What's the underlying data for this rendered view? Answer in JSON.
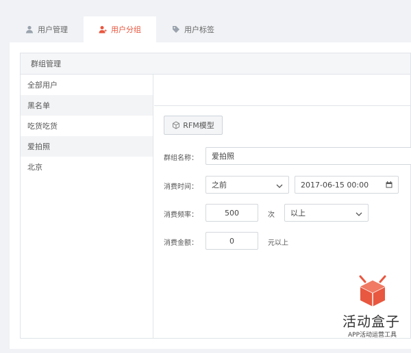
{
  "tabs": [
    {
      "label": "用户管理",
      "icon": "user-icon"
    },
    {
      "label": "用户分组",
      "icon": "user-group-icon",
      "active": true
    },
    {
      "label": "用户标签",
      "icon": "tag-icon"
    }
  ],
  "panel": {
    "title": "群组管理"
  },
  "sidebar": {
    "items": [
      {
        "label": "全部用户"
      },
      {
        "label": "黑名单"
      },
      {
        "label": "吃货吃货"
      },
      {
        "label": "爱拍照"
      },
      {
        "label": "北京"
      }
    ]
  },
  "form": {
    "rfm_button": "RFM模型",
    "group_name_label": "群组名称：",
    "group_name_value": "爱拍照",
    "time_label": "消费时间：",
    "time_select": "之前",
    "time_date": "2017-06-15 00:00",
    "freq_label": "消费频率：",
    "freq_value": "500",
    "freq_unit": "次",
    "freq_select": "以上",
    "amount_label": "消费金额：",
    "amount_value": "0",
    "amount_unit": "元以上"
  },
  "watermark": {
    "brand": "活动盒子",
    "tagline": "APP活动运营工具"
  },
  "colors": {
    "accent": "#e8573f",
    "logo": "#e8573f"
  }
}
